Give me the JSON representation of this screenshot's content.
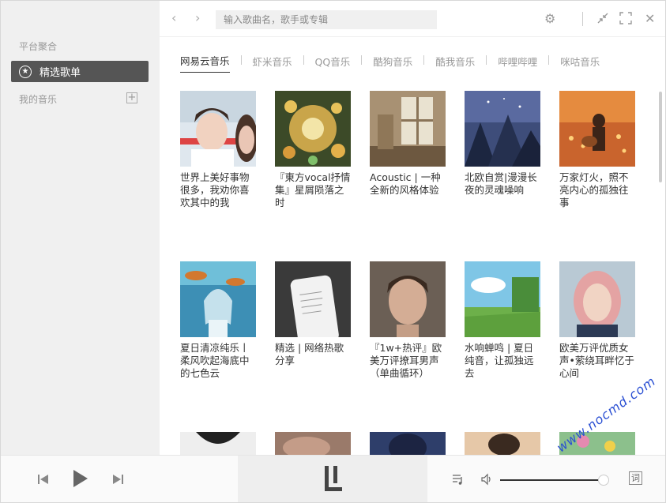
{
  "sidebar": {
    "platform_heading": "平台聚合",
    "active_item": "精选歌单",
    "my_music_heading": "我的音乐",
    "add_symbol": "+"
  },
  "topbar": {
    "search_placeholder": "输入歌曲名，歌手或专辑"
  },
  "tabs": [
    {
      "label": "网易云音乐",
      "active": true
    },
    {
      "label": "虾米音乐",
      "active": false
    },
    {
      "label": "QQ音乐",
      "active": false
    },
    {
      "label": "酷狗音乐",
      "active": false
    },
    {
      "label": "酷我音乐",
      "active": false
    },
    {
      "label": "哔哩哔哩",
      "active": false
    },
    {
      "label": "咪咕音乐",
      "active": false
    }
  ],
  "playlists": [
    {
      "title": "世界上美好事物很多，我劝你喜欢其中的我",
      "cover": "portrait-boy"
    },
    {
      "title": "『東方vocal抒情集』星屑陨落之时",
      "cover": "anime-lanterns"
    },
    {
      "title": "Acoustic | 一种全新的风格体验",
      "cover": "window-room"
    },
    {
      "title": "北欧自赏|漫漫长夜的灵魂噪响",
      "cover": "snowy-night"
    },
    {
      "title": "万家灯火，照不亮内心的孤独往事",
      "cover": "guitar-lights"
    },
    {
      "title": "夏日清凉纯乐丨柔风吹起海底中的七色云",
      "cover": "underwater-girl"
    },
    {
      "title": "精选 | 网络热歌分享",
      "cover": "phone-notes"
    },
    {
      "title": "『1w+热评』欧美万评撩耳男声（单曲循环）",
      "cover": "portrait-man"
    },
    {
      "title": "水响蝉鸣 | 夏日纯音，让孤独远去",
      "cover": "summer-field"
    },
    {
      "title": "欧美万评优质女声•萦绕耳畔忆于心间",
      "cover": "portrait-woman"
    },
    {
      "title": "",
      "cover": "row3-a"
    },
    {
      "title": "",
      "cover": "row3-b"
    },
    {
      "title": "",
      "cover": "row3-c"
    },
    {
      "title": "",
      "cover": "row3-d"
    },
    {
      "title": "",
      "cover": "row3-e"
    }
  ],
  "player": {
    "volume_level": 0.94,
    "lyric_label": "词"
  },
  "watermark": "www.nocmd.com"
}
